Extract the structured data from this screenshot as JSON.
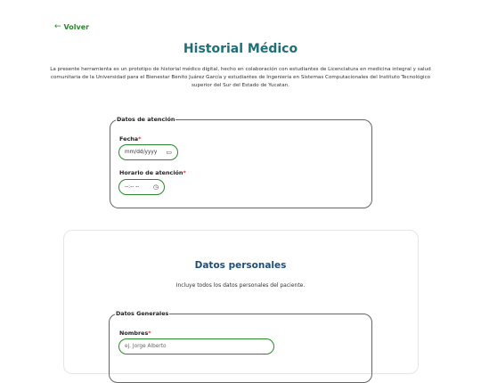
{
  "nav": {
    "back_label": "Volver"
  },
  "page": {
    "title": "Historial Médico",
    "intro": "La presente herramienta es un prototipo de historial médico digital, hecho en colaboración con estudiantes de Licenciatura en medicina integral y salud comunitaria de la Universidad para el Bienestar Benito Juárez García y estudiantes de Ingeniería en Sistemas Computacionales del Instituto Tecnológico superior del Sur del Estado de Yucatan."
  },
  "attention": {
    "legend": "Datos de atención",
    "date_label": "Fecha",
    "date_placeholder": "mm/dd/yyyy",
    "time_label": "Horario de atención",
    "time_placeholder": "--:-- --",
    "required_mark": "*"
  },
  "personal": {
    "title": "Datos personales",
    "subtitle": "Incluye todos los datos personales del paciente.",
    "legend": "Datos Generales",
    "names_label": "Nombres",
    "names_placeholder": "ej. Jorge Alberto"
  },
  "colors": {
    "accent_green": "#2a8a2a",
    "title_teal": "#1f6f78",
    "required_red": "#d33333"
  },
  "icons": {
    "back": "arrow-left-icon",
    "calendar": "calendar-icon",
    "clock": "clock-icon"
  }
}
